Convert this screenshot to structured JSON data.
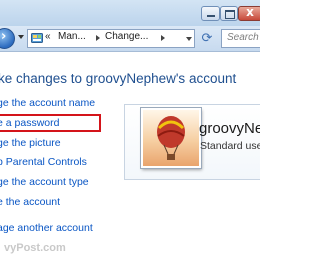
{
  "window": {
    "close_glyph": "x"
  },
  "navbar": {
    "crumbs": [
      "«",
      "Man...",
      "Change..."
    ],
    "search_placeholder": "Search"
  },
  "content": {
    "page_title": "ke changes to groovyNephew's account",
    "tasks": [
      {
        "label": "ge the account name"
      },
      {
        "label": "e a password"
      },
      {
        "label": "ge the picture"
      },
      {
        "label": "p Parental Controls"
      },
      {
        "label": "ge the account type"
      },
      {
        "label": "e the account"
      },
      {
        "label": "age another account"
      }
    ]
  },
  "user_card": {
    "name": "groovyNephew",
    "type": "Standard user"
  },
  "watermark": "vyPost.com",
  "colors": {
    "link": "#0a56c4",
    "title": "#1f4f8f",
    "highlight_border": "#d4141a"
  },
  "icons": {
    "control_panel": "control-panel-icon",
    "refresh": "refresh-icon",
    "avatar": "hot-air-balloon-picture"
  }
}
